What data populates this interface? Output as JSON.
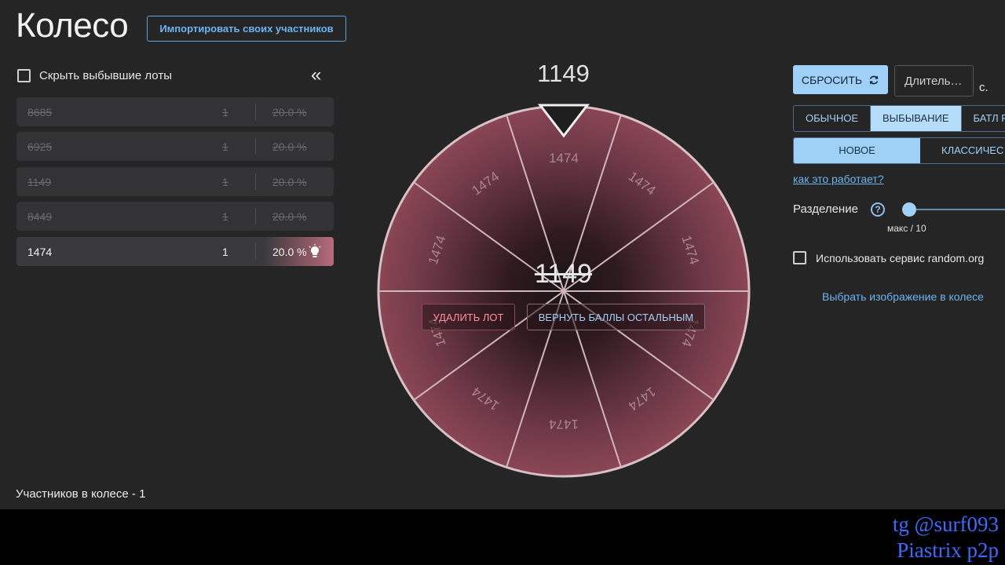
{
  "header": {
    "title": "Колесо",
    "import_label": "Импортировать своих участников"
  },
  "sidebar": {
    "hide_label": "Скрыть выбывшие лоты",
    "collapse_icon": "«",
    "lots": [
      {
        "name": "8685",
        "amount": "1",
        "percent": "20.0 %",
        "out": true
      },
      {
        "name": "6925",
        "amount": "1",
        "percent": "20.0 %",
        "out": true
      },
      {
        "name": "1149",
        "amount": "1",
        "percent": "20.0 %",
        "out": true
      },
      {
        "name": "8449",
        "amount": "1",
        "percent": "20.0 %",
        "out": true
      },
      {
        "name": "1474",
        "amount": "1",
        "percent": "20.0 %",
        "out": false
      }
    ],
    "participants": "Участников в колесе - 1"
  },
  "wheel": {
    "winner": "1149",
    "center_label": "1149",
    "segment_label": "1474",
    "segment_count": 10,
    "delete_label": "УДАЛИТЬ ЛОТ",
    "return_label": "ВЕРНУТЬ БАЛЛЫ ОСТАЛЬНЫМ"
  },
  "controls": {
    "reset_label": "СБРОСИТЬ",
    "duration_placeholder": "Длитель…",
    "seconds_unit": "с.",
    "modes": [
      "ОБЫЧНОЕ",
      "ВЫБЫВАНИЕ",
      "БАТЛ Р"
    ],
    "selected_mode": "ВЫБЫВАНИЕ",
    "sub_modes": [
      "НОВОЕ",
      "КЛАССИЧЕС"
    ],
    "how_link": "как это работает?",
    "split_label": "Разделение",
    "help_icon": "?",
    "split_max": "макс / 10",
    "random_label": "Использовать сервис random.org",
    "image_link": "Выбрать изображение в колесе"
  },
  "watermark": {
    "line1": "tg @surf093",
    "line2": "Piastrix p2p"
  },
  "colors": {
    "accent": "#9fd0f5",
    "link": "#6cb4f0",
    "wheel": "#8a4655",
    "danger": "#ff8fa1"
  }
}
